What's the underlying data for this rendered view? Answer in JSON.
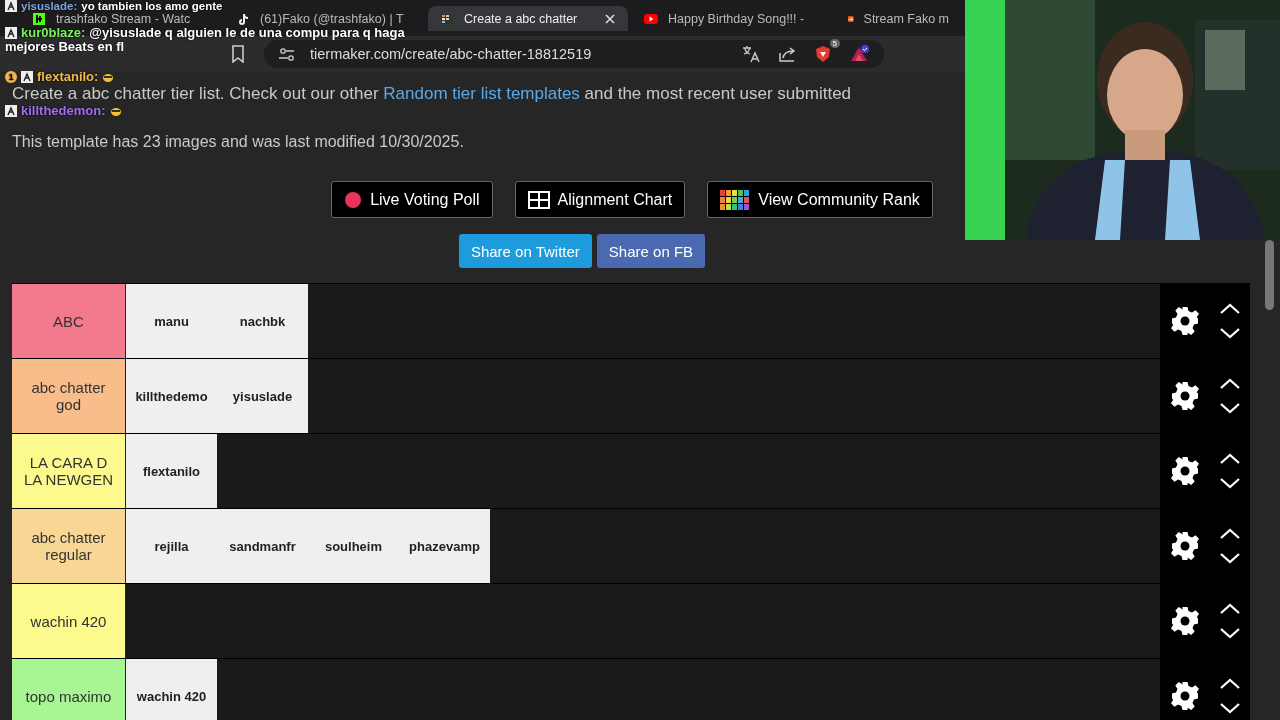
{
  "browser": {
    "tabs": [
      {
        "title": "trashfako Stream - Watc",
        "selected": false
      },
      {
        "title": "(61)Fako (@trashfako) | T",
        "selected": false
      },
      {
        "title": "Create a abc chatter",
        "selected": true
      },
      {
        "title": "Happy Birthday Song!!! -",
        "selected": false
      },
      {
        "title": "Stream Fako m",
        "selected": false
      }
    ],
    "url": "tiermaker.com/create/abc-chatter-18812519",
    "shield_count": "5"
  },
  "page": {
    "intro": {
      "before": "Create a abc chatter tier list. Check out our other ",
      "link": "Random tier list templates",
      "after": " and the most recent user submitted"
    },
    "template_info": "This template has 23 images and was last modified 10/30/2025.",
    "action_buttons": [
      {
        "label": "Live Voting Poll",
        "kind": "poll"
      },
      {
        "label": "Alignment Chart",
        "kind": "alignment"
      },
      {
        "label": "View Community Rank",
        "kind": "rank"
      }
    ],
    "share_buttons": [
      {
        "label": "Share on Twitter",
        "kind": "twitter"
      },
      {
        "label": "Share on FB",
        "kind": "facebook"
      }
    ]
  },
  "tier_list": {
    "tiers": [
      {
        "label": "ABC",
        "color": "#f27a8c",
        "items": [
          "manu",
          "nachbk"
        ]
      },
      {
        "label": "abc chatter god",
        "color": "#f9bd8c",
        "items": [
          "killthedemo",
          "yisuslade"
        ]
      },
      {
        "label": "LA CARA D LA NEWGEN",
        "color": "#fcf98d",
        "items": [
          "flextanilo"
        ]
      },
      {
        "label": "abc chatter regular",
        "color": "#f8d794",
        "items": [
          "rejilla",
          "sandmanfr",
          "soulheim",
          "phazevamp"
        ]
      },
      {
        "label": "wachin 420",
        "color": "#fcf98d"
      },
      {
        "label": "topo maximo",
        "color": "#a8f594",
        "items": [
          "wachin 420"
        ]
      }
    ]
  },
  "chat": {
    "messages": [
      {
        "user": "yisuslade:",
        "color": "#7fa6e0",
        "text_lines": [
          "yo tambien los amo gente"
        ]
      },
      {
        "user": "kur0blaze:",
        "color": "#7cf05a",
        "text_lines": [
          "@yisuslade q alguien le de una compu para q haga",
          "mejores Beats en fl"
        ]
      },
      {
        "user": "flextanilo:",
        "color": "#f2b84b",
        "badge": "1"
      },
      {
        "user": "killthedemon:",
        "color": "#a46cf0"
      }
    ]
  }
}
